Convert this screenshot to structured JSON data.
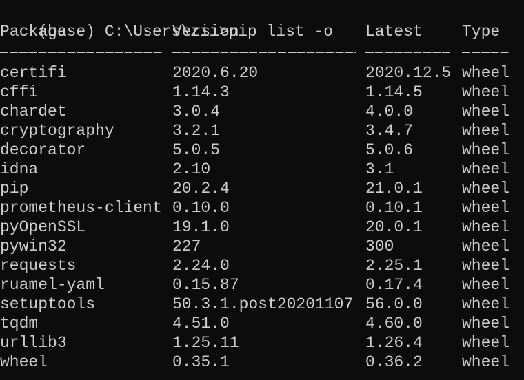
{
  "terminal": {
    "prompt": "(base) C:\\Users\\zii>",
    "command": "pip list -o",
    "colors": {
      "background": "#0c0c0c",
      "foreground": "#cccccc"
    }
  },
  "table": {
    "headers": {
      "package": "Package",
      "version": "Version",
      "latest": "Latest",
      "type": "Type"
    },
    "separators": {
      "package": "-----------------",
      "version": "-------------------",
      "latest": "---------",
      "type": "-----"
    },
    "rows": [
      {
        "package": "certifi",
        "version": "2020.6.20",
        "latest": "2020.12.5",
        "type": "wheel"
      },
      {
        "package": "cffi",
        "version": "1.14.3",
        "latest": "1.14.5",
        "type": "wheel"
      },
      {
        "package": "chardet",
        "version": "3.0.4",
        "latest": "4.0.0",
        "type": "wheel"
      },
      {
        "package": "cryptography",
        "version": "3.2.1",
        "latest": "3.4.7",
        "type": "wheel"
      },
      {
        "package": "decorator",
        "version": "5.0.5",
        "latest": "5.0.6",
        "type": "wheel"
      },
      {
        "package": "idna",
        "version": "2.10",
        "latest": "3.1",
        "type": "wheel"
      },
      {
        "package": "pip",
        "version": "20.2.4",
        "latest": "21.0.1",
        "type": "wheel"
      },
      {
        "package": "prometheus-client",
        "version": "0.10.0",
        "latest": "0.10.1",
        "type": "wheel"
      },
      {
        "package": "pyOpenSSL",
        "version": "19.1.0",
        "latest": "20.0.1",
        "type": "wheel"
      },
      {
        "package": "pywin32",
        "version": "227",
        "latest": "300",
        "type": "wheel"
      },
      {
        "package": "requests",
        "version": "2.24.0",
        "latest": "2.25.1",
        "type": "wheel"
      },
      {
        "package": "ruamel-yaml",
        "version": "0.15.87",
        "latest": "0.17.4",
        "type": "wheel"
      },
      {
        "package": "setuptools",
        "version": "50.3.1.post20201107",
        "latest": "56.0.0",
        "type": "wheel"
      },
      {
        "package": "tqdm",
        "version": "4.51.0",
        "latest": "4.60.0",
        "type": "wheel"
      },
      {
        "package": "urllib3",
        "version": "1.25.11",
        "latest": "1.26.4",
        "type": "wheel"
      },
      {
        "package": "wheel",
        "version": "0.35.1",
        "latest": "0.36.2",
        "type": "wheel"
      }
    ]
  }
}
